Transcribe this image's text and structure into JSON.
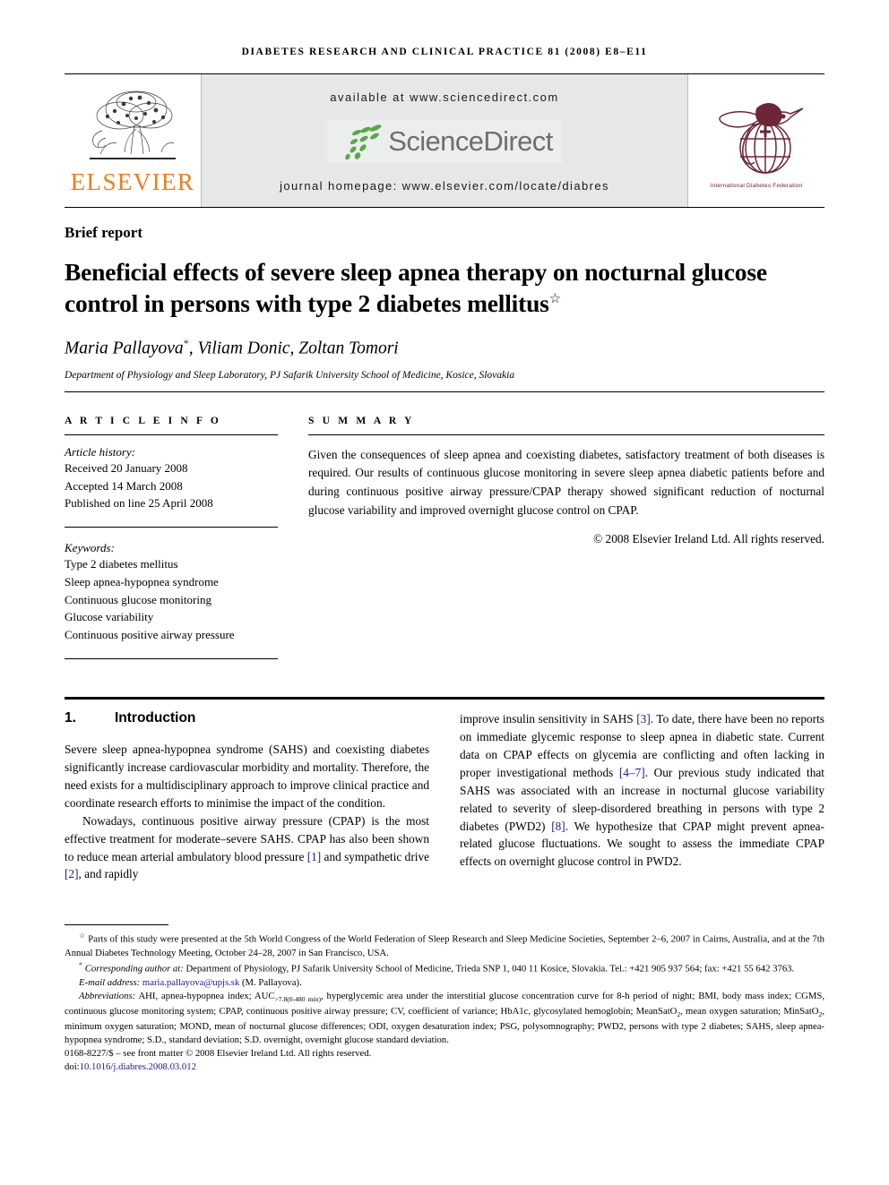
{
  "running_head": "DIABETES RESEARCH AND CLINICAL PRACTICE 81 (2008) e8–e11",
  "masthead": {
    "publisher_name": "ELSEVIER",
    "available_at": "available at www.sciencedirect.com",
    "sciencedirect_word": "ScienceDirect",
    "journal_homepage": "journal homepage: www.elsevier.com/locate/diabres",
    "society_caption": "International Diabetes Federation",
    "colors": {
      "elsevier_orange": "#f07d1a",
      "sciencedirect_gray": "#6d6e70",
      "sciencedirect_green": "#57a846",
      "idf_maroon": "#6b2737",
      "banner_bg": "#e6e7e8"
    }
  },
  "article": {
    "category": "Brief report",
    "title": "Beneficial effects of severe sleep apnea therapy on nocturnal glucose control in persons with type 2 diabetes mellitus",
    "title_footnote_mark": "☆",
    "authors": "Maria Pallayova",
    "authors_rest": ", Viliam Donic, Zoltan Tomori",
    "corresponding_mark": "*",
    "affiliation": "Department of Physiology and Sleep Laboratory, PJ Safarik University School of Medicine, Kosice, Slovakia"
  },
  "article_info": {
    "heading": "A R T I C L E  I N F O",
    "history_label": "Article history:",
    "history": [
      "Received 20 January 2008",
      "Accepted 14 March 2008",
      "Published on line 25 April 2008"
    ],
    "keywords_label": "Keywords:",
    "keywords": [
      "Type 2 diabetes mellitus",
      "Sleep apnea-hypopnea syndrome",
      "Continuous glucose monitoring",
      "Glucose variability",
      "Continuous positive airway pressure"
    ]
  },
  "summary": {
    "heading": "S U M M A R Y",
    "text": "Given the consequences of sleep apnea and coexisting diabetes, satisfactory treatment of both diseases is required. Our results of continuous glucose monitoring in severe sleep apnea diabetic patients before and during continuous positive airway pressure/CPAP therapy showed significant reduction of nocturnal glucose variability and improved overnight glucose control on CPAP.",
    "copyright": "© 2008 Elsevier Ireland Ltd. All rights reserved."
  },
  "introduction": {
    "number": "1.",
    "heading": "Introduction",
    "left_paragraph_1": "Severe sleep apnea-hypopnea syndrome (SAHS) and coexisting diabetes significantly increase cardiovascular morbidity and mortality. Therefore, the need exists for a multidisciplinary approach to improve clinical practice and coordinate research efforts to minimise the impact of the condition.",
    "left_paragraph_2_a": "Nowadays, continuous positive airway pressure (CPAP) is the most effective treatment for moderate–severe SAHS. CPAP has also been shown to reduce mean arterial ambulatory blood pressure ",
    "left_ref_1": "[1]",
    "left_paragraph_2_b": " and sympathetic drive ",
    "left_ref_2": "[2]",
    "left_paragraph_2_c": ", and rapidly",
    "right_paragraph_a": "improve insulin sensitivity in SAHS ",
    "right_ref_3": "[3]",
    "right_paragraph_b": ". To date, there have been no reports on immediate glycemic response to sleep apnea in diabetic state. Current data on CPAP effects on glycemia are conflicting and often lacking in proper investigational methods ",
    "right_ref_4": "[4–7]",
    "right_paragraph_c": ". Our previous study indicated that SAHS was associated with an increase in nocturnal glucose variability related to severity of sleep-disordered breathing in persons with type 2 diabetes (PWD2) ",
    "right_ref_8": "[8]",
    "right_paragraph_d": ". We hypothesize that CPAP might prevent apnea-related glucose fluctuations. We sought to assess the immediate CPAP effects on overnight glucose control in PWD2."
  },
  "footnotes": {
    "star_mark": "☆",
    "star_text": "Parts of this study were presented at the 5th World Congress of the World Federation of Sleep Research and Sleep Medicine Societies, September 2–6, 2007 in Cairns, Australia, and at the 7th Annual Diabetes Technology Meeting, October 24–28, 2007 in San Francisco, USA.",
    "corr_mark": "*",
    "corr_italic": "Corresponding author at:",
    "corr_text": " Department of Physiology, PJ Safarik University School of Medicine, Trieda SNP 1, 040 11 Kosice, Slovakia. Tel.: +421 905 937 564; fax: +421 55 642 3763.",
    "email_label": "E-mail address:",
    "email": "maria.pallayova@upjs.sk",
    "email_suffix": "(M. Pallayova).",
    "abbrev_label": "Abbreviations:",
    "abbrev_a": " AHI, apnea-hypopnea index; AUC",
    "abbrev_sub": ">7.8(0-480 min)",
    "abbrev_b": ", hyperglycemic area under the interstitial glucose concentration curve for 8-h period of night; BMI, body mass index; CGMS, continuous glucose monitoring system; CPAP, continuous positive airway pressure; CV, coefficient of variance; HbA1c, glycosylated hemoglobin; MeanSatO",
    "abbrev_sub2": "2",
    "abbrev_c": ", mean oxygen saturation; MinSatO",
    "abbrev_sub3": "2",
    "abbrev_d": ", minimum oxygen saturation; MOND, mean of nocturnal glucose differences; ODI, oxygen desaturation index; PSG, polysomnography; PWD2, persons with type 2 diabetes; SAHS, sleep apnea-hypopnea syndrome; S.D., standard deviation; S.D. overnight, overnight glucose standard deviation.",
    "issn_line": "0168-8227/$ – see front matter © 2008 Elsevier Ireland Ltd. All rights reserved.",
    "doi_label": "doi:",
    "doi_value": "10.1016/j.diabres.2008.03.012"
  }
}
